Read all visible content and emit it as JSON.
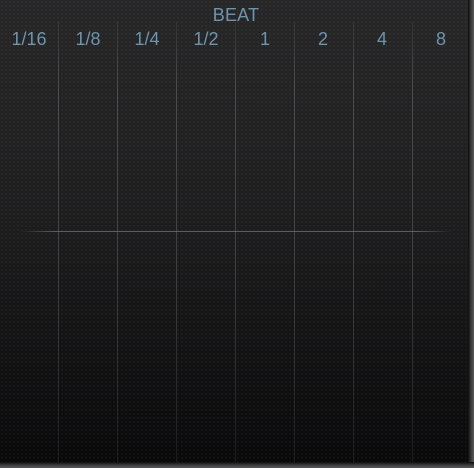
{
  "beat_panel": {
    "title": "BEAT",
    "labels": [
      "1/16",
      "1/8",
      "1/4",
      "1/2",
      "1",
      "2",
      "4",
      "8"
    ]
  },
  "colors": {
    "label": "#6e93ad",
    "background": "#1e1e1f",
    "divider": "#6e6e72"
  }
}
